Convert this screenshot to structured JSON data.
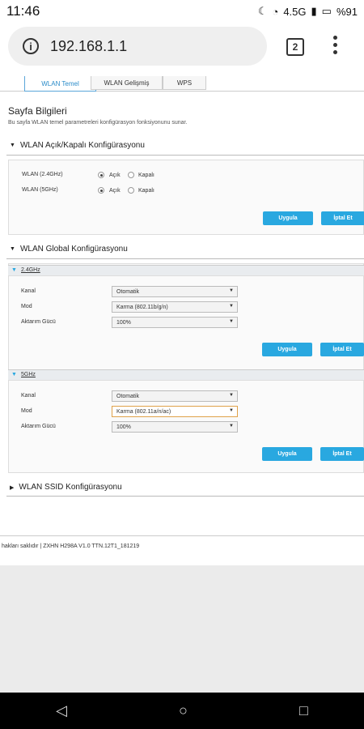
{
  "status": {
    "time": "11:46",
    "network": "4.5G",
    "battery": "%91"
  },
  "browser": {
    "url": "192.168.1.1",
    "tab_count": "2"
  },
  "tabs": [
    "WLAN Temel",
    "WLAN Gelişmiş",
    "WPS"
  ],
  "page": {
    "title": "Sayfa Bilgileri",
    "description": "Bu sayfa WLAN temel parametreleri konfigürasyon fonksiyonunu sunar."
  },
  "onoff": {
    "header": "WLAN Açık/Kapalı Konfigürasyonu",
    "rows": [
      {
        "label": "WLAN (2.4GHz)",
        "on": "Açık",
        "off": "Kapalı"
      },
      {
        "label": "WLAN (5GHz)",
        "on": "Açık",
        "off": "Kapalı"
      }
    ],
    "apply": "Uygula",
    "cancel": "İptal Et"
  },
  "global": {
    "header": "WLAN Global Konfigürasyonu",
    "band24": {
      "title": "2.4GHz",
      "labels": [
        "Kanal",
        "Mod",
        "Aktarım Gücü"
      ],
      "values": [
        "Otomatik",
        "Karma (802.11b/g/n)",
        "100%"
      ]
    },
    "band5": {
      "title": "5GHz",
      "labels": [
        "Kanal",
        "Mod",
        "Aktarım Gücü"
      ],
      "values": [
        "Otomatik",
        "Karma (802.11a/n/ac)",
        "100%"
      ]
    },
    "apply": "Uygula",
    "cancel": "İptal Et"
  },
  "ssid": {
    "header": "WLAN SSID Konfigürasyonu"
  },
  "footer": {
    "text": "hakları saklıdır  |  ZXHN H298A V1.0 TTN.12T1_181219"
  }
}
